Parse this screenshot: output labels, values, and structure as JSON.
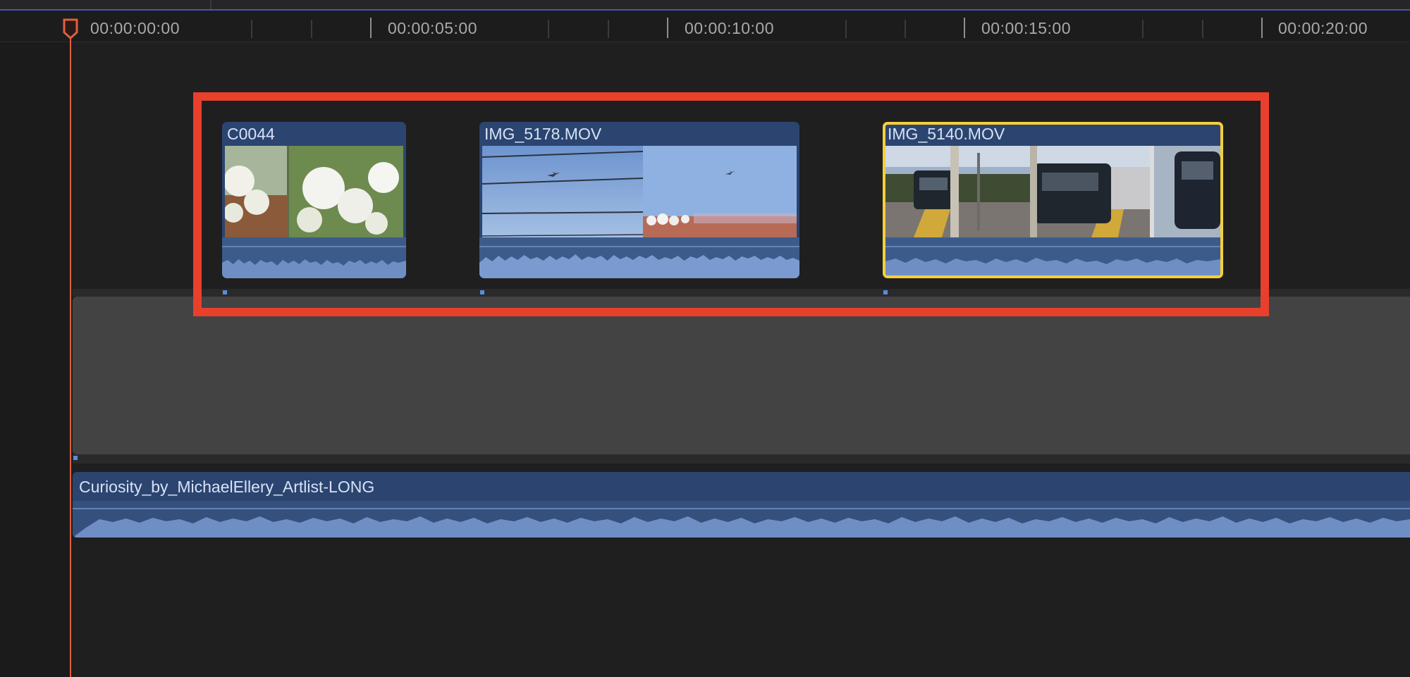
{
  "ruler": {
    "timecodes": [
      "00:00:00:00",
      "00:00:05:00",
      "00:00:10:00",
      "00:00:15:00",
      "00:00:20:00"
    ]
  },
  "clips": [
    {
      "label": "C0044",
      "selected": false
    },
    {
      "label": "IMG_5178.MOV",
      "selected": false
    },
    {
      "label": "IMG_5140.MOV",
      "selected": true
    }
  ],
  "music_clip": {
    "label": "Curiosity_by_MichaelEllery_Artlist-LONG"
  },
  "colors": {
    "playhead": "#e0603f",
    "selection_outline": "#f4cf3b",
    "highlight_box": "#e8402b",
    "clip_fill": "#2b4570",
    "waveform": "#6f8fc4"
  }
}
